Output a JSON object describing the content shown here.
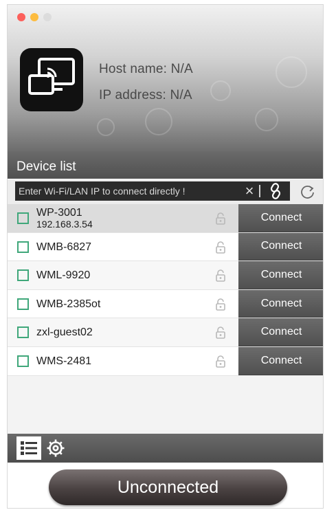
{
  "window": {
    "traffic_lights": [
      "close",
      "minimize",
      "zoom"
    ]
  },
  "header": {
    "host_name_label": "Host name:",
    "host_name_value": "N/A",
    "ip_address_label": "IP address:",
    "ip_address_value": "N/A",
    "app_icon": "screen-cast-icon"
  },
  "device_list": {
    "title": "Device list",
    "ip_input_placeholder": "Enter Wi-Fi/LAN IP to connect directly !",
    "ip_input_value": "",
    "clear_icon": "×",
    "devices": [
      {
        "name": "WP-3001",
        "ip": "192.168.3.54",
        "connect_label": "Connect",
        "selected": true
      },
      {
        "name": "WMB-6827",
        "ip": "",
        "connect_label": "Connect",
        "selected": false
      },
      {
        "name": "WML-9920",
        "ip": "",
        "connect_label": "Connect",
        "selected": false
      },
      {
        "name": "WMB-2385ot",
        "ip": "",
        "connect_label": "Connect",
        "selected": false
      },
      {
        "name": "zxl-guest02",
        "ip": "",
        "connect_label": "Connect",
        "selected": false
      },
      {
        "name": "WMS-2481",
        "ip": "",
        "connect_label": "Connect",
        "selected": false
      }
    ]
  },
  "tabs": [
    {
      "id": "list",
      "icon": "list-icon",
      "active": true
    },
    {
      "id": "settings",
      "icon": "gear-icon",
      "active": false
    }
  ],
  "status": {
    "label": "Unconnected"
  },
  "colors": {
    "checkbox": "#3fa77a",
    "connect_button": "#5a5a5a",
    "status_button": "#3f3838"
  }
}
